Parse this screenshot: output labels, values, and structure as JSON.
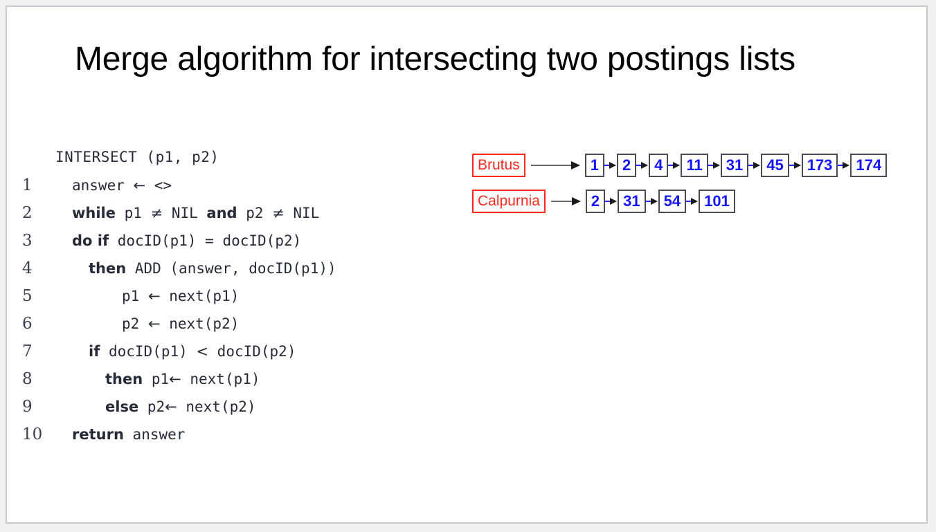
{
  "slide": {
    "title": "Merge algorithm for intersecting two postings lists",
    "background_color": "#ffffff",
    "border_color": "#c7c9d1"
  },
  "pseudocode": {
    "header": "INTERSECT (p1, p2)",
    "lines": [
      {
        "number": "1",
        "indent": 1,
        "segments": [
          {
            "text": "answer ",
            "style": "plain"
          },
          {
            "text": "←",
            "style": "sym"
          },
          {
            "text": " <>",
            "style": "plain"
          }
        ]
      },
      {
        "number": "2",
        "indent": 1,
        "segments": [
          {
            "text": "while",
            "style": "kw"
          },
          {
            "text": " p1 ",
            "style": "plain"
          },
          {
            "text": "≠",
            "style": "sym"
          },
          {
            "text": " NIL ",
            "style": "plain"
          },
          {
            "text": "and",
            "style": "kw"
          },
          {
            "text": " p2 ",
            "style": "plain"
          },
          {
            "text": "≠",
            "style": "sym"
          },
          {
            "text": " NIL",
            "style": "plain"
          }
        ]
      },
      {
        "number": "3",
        "indent": 1,
        "segments": [
          {
            "text": "do if",
            "style": "kw"
          },
          {
            "text": " docID(p1) = docID(p2)",
            "style": "plain"
          }
        ]
      },
      {
        "number": "4",
        "indent": 2,
        "segments": [
          {
            "text": "then",
            "style": "kw"
          },
          {
            "text": " ADD (answer, docID(p1))",
            "style": "plain"
          }
        ]
      },
      {
        "number": "5",
        "indent": 4,
        "segments": [
          {
            "text": "p1 ",
            "style": "plain"
          },
          {
            "text": "←",
            "style": "sym"
          },
          {
            "text": " next(p1)",
            "style": "plain"
          }
        ]
      },
      {
        "number": "6",
        "indent": 4,
        "segments": [
          {
            "text": "p2 ",
            "style": "plain"
          },
          {
            "text": "←",
            "style": "sym"
          },
          {
            "text": " next(p2)",
            "style": "plain"
          }
        ]
      },
      {
        "number": "7",
        "indent": 2,
        "segments": [
          {
            "text": "if",
            "style": "kw"
          },
          {
            "text": " docID(p1) ",
            "style": "plain"
          },
          {
            "text": "<",
            "style": "sym"
          },
          {
            "text": " docID(p2)",
            "style": "plain"
          }
        ]
      },
      {
        "number": "8",
        "indent": 3,
        "segments": [
          {
            "text": "then",
            "style": "kw"
          },
          {
            "text": " p1",
            "style": "plain"
          },
          {
            "text": "←",
            "style": "sym"
          },
          {
            "text": " next(p1)",
            "style": "plain"
          }
        ]
      },
      {
        "number": "9",
        "indent": 3,
        "segments": [
          {
            "text": "else",
            "style": "kw"
          },
          {
            "text": " p2",
            "style": "plain"
          },
          {
            "text": "←",
            "style": "sym"
          },
          {
            "text": " next(p2)",
            "style": "plain"
          }
        ]
      },
      {
        "number": "10",
        "indent": 1,
        "segments": [
          {
            "text": "return",
            "style": "kw"
          },
          {
            "text": " answer",
            "style": "plain"
          }
        ]
      }
    ]
  },
  "postings": {
    "term_color": "#ff2a1f",
    "docid_color": "#1414ff",
    "box_border_color": "#4a4a52",
    "rows": [
      {
        "term": "Brutus",
        "lead_arrow_length": 62,
        "docids": [
          "1",
          "2",
          "4",
          "11",
          "31",
          "45",
          "173",
          "174"
        ]
      },
      {
        "term": "Calpurnia",
        "lead_arrow_length": 34,
        "docids": [
          "2",
          "31",
          "54",
          "101"
        ]
      }
    ]
  }
}
